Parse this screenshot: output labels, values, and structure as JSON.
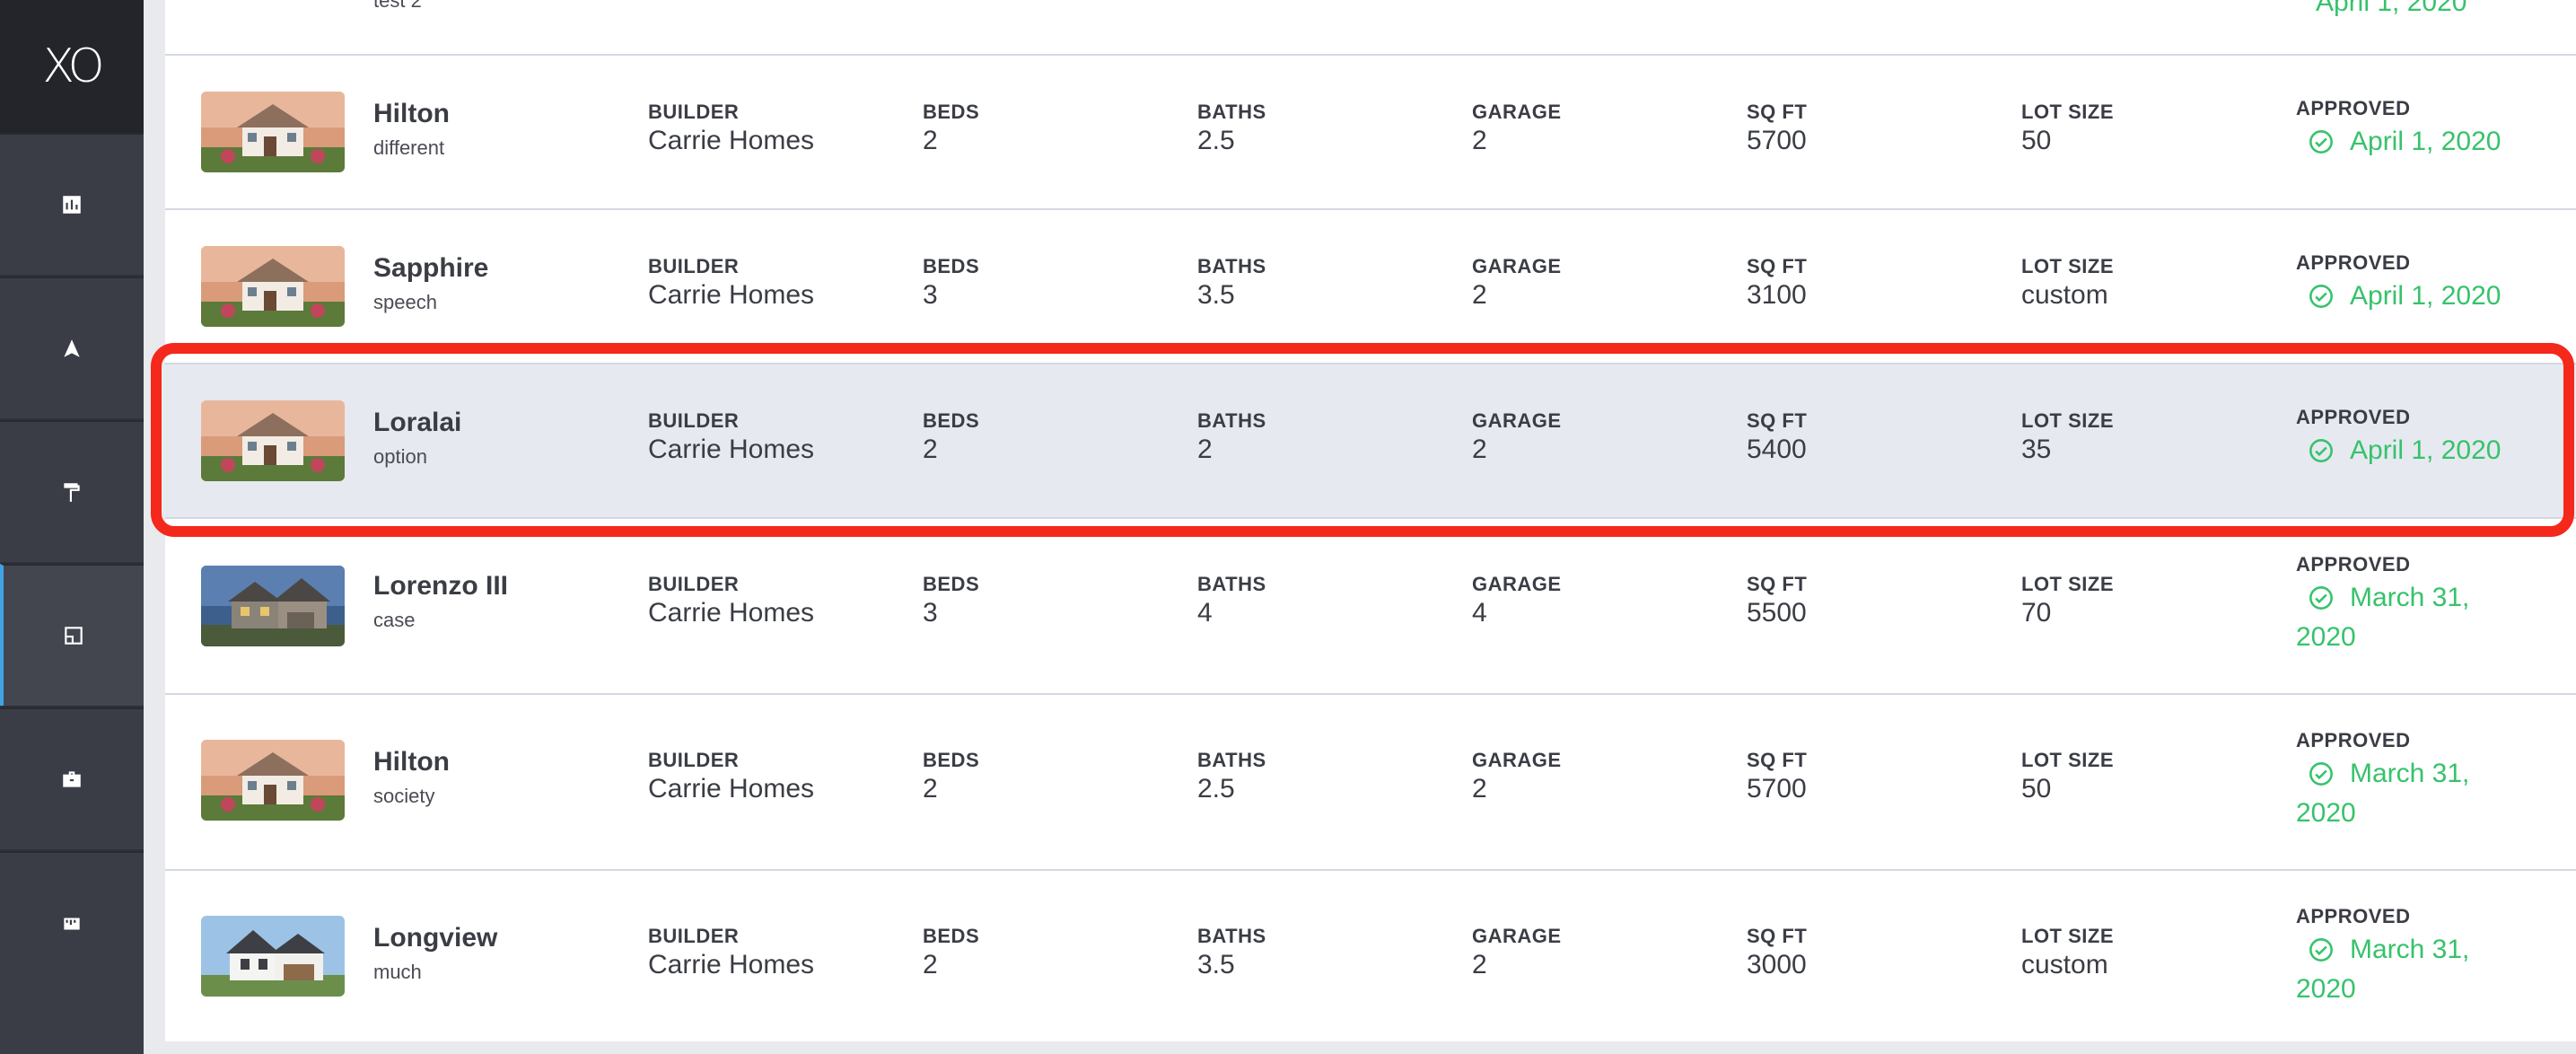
{
  "app": {
    "logo": "XO"
  },
  "sidebar": {
    "items": [
      {
        "icon": "bar-chart-icon",
        "label": ""
      },
      {
        "icon": "navigation-arrow-icon",
        "label": ""
      },
      {
        "icon": "paint-roller-icon",
        "label": ""
      },
      {
        "icon": "floor-plan-icon",
        "label": "",
        "active": true
      },
      {
        "icon": "briefcase-icon",
        "label": ""
      },
      {
        "icon": "ruler-icon",
        "label": ""
      }
    ]
  },
  "top_partial": {
    "subtitle": "test 2",
    "date": "April 1, 2020"
  },
  "labels": {
    "builder": "BUILDER",
    "beds": "BEDS",
    "baths": "BATHS",
    "garage": "GARAGE",
    "sqft": "SQ FT",
    "lot": "LOT SIZE",
    "approved": "APPROVED"
  },
  "rows": [
    {
      "name": "Hilton",
      "sub": "different",
      "builder": "Carrie Homes",
      "beds": "2",
      "baths": "2.5",
      "garage": "2",
      "sqft": "5700",
      "lot": "50",
      "approved_l1": "April 1, 2020",
      "approved_l2": ""
    },
    {
      "name": "Sapphire",
      "sub": "speech",
      "builder": "Carrie Homes",
      "beds": "3",
      "baths": "3.5",
      "garage": "2",
      "sqft": "3100",
      "lot": "custom",
      "approved_l1": "April 1, 2020",
      "approved_l2": ""
    },
    {
      "name": "Loralai",
      "sub": "option",
      "builder": "Carrie Homes",
      "beds": "2",
      "baths": "2",
      "garage": "2",
      "sqft": "5400",
      "lot": "35",
      "approved_l1": "April 1, 2020",
      "approved_l2": ""
    },
    {
      "name": "Lorenzo III",
      "sub": "case",
      "builder": "Carrie Homes",
      "beds": "3",
      "baths": "4",
      "garage": "4",
      "sqft": "5500",
      "lot": "70",
      "approved_l1": "March 31,",
      "approved_l2": "2020"
    },
    {
      "name": "Hilton",
      "sub": "society",
      "builder": "Carrie Homes",
      "beds": "2",
      "baths": "2.5",
      "garage": "2",
      "sqft": "5700",
      "lot": "50",
      "approved_l1": "March 31,",
      "approved_l2": "2020"
    },
    {
      "name": "Longview",
      "sub": "much",
      "builder": "Carrie Homes",
      "beds": "2",
      "baths": "3.5",
      "garage": "2",
      "sqft": "3000",
      "lot": "custom",
      "approved_l1": "March 31,",
      "approved_l2": "2020"
    }
  ],
  "colors": {
    "accent_green": "#37c26b",
    "highlight_red": "#f4281b",
    "sidebar": "#2f3038",
    "active_indicator": "#3fa3e6"
  }
}
